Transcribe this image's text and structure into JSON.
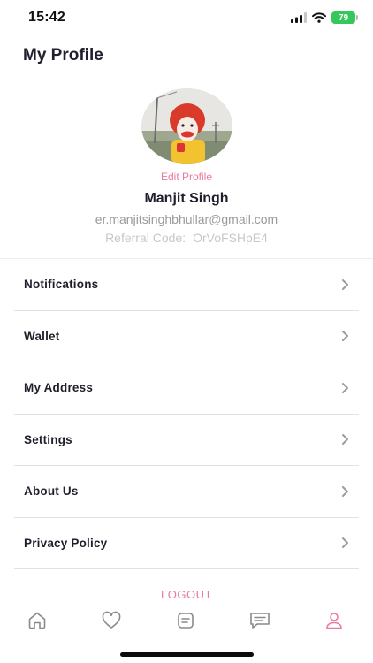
{
  "status_bar": {
    "time": "15:42",
    "battery": "79"
  },
  "header": {
    "title": "My Profile"
  },
  "profile": {
    "edit_label": "Edit Profile",
    "name": "Manjit Singh",
    "email": "er.manjitsinghbhullar@gmail.com",
    "referral_label": "Referral Code:",
    "referral_code": "OrVoFSHpE4"
  },
  "menu": {
    "items": [
      {
        "label": "Notifications"
      },
      {
        "label": "Wallet"
      },
      {
        "label": "My Address"
      },
      {
        "label": "Settings"
      },
      {
        "label": "About Us"
      },
      {
        "label": "Privacy Policy"
      }
    ]
  },
  "logout_label": "LOGOUT",
  "tabbar": {
    "tabs": [
      {
        "icon": "home-icon"
      },
      {
        "icon": "heart-icon"
      },
      {
        "icon": "orders-icon"
      },
      {
        "icon": "chat-icon"
      },
      {
        "icon": "profile-icon",
        "active": true
      }
    ]
  },
  "colors": {
    "accent": "#e87aa6",
    "text": "#1f1f2b",
    "muted": "#9a9a9a",
    "battery": "#34c759"
  }
}
